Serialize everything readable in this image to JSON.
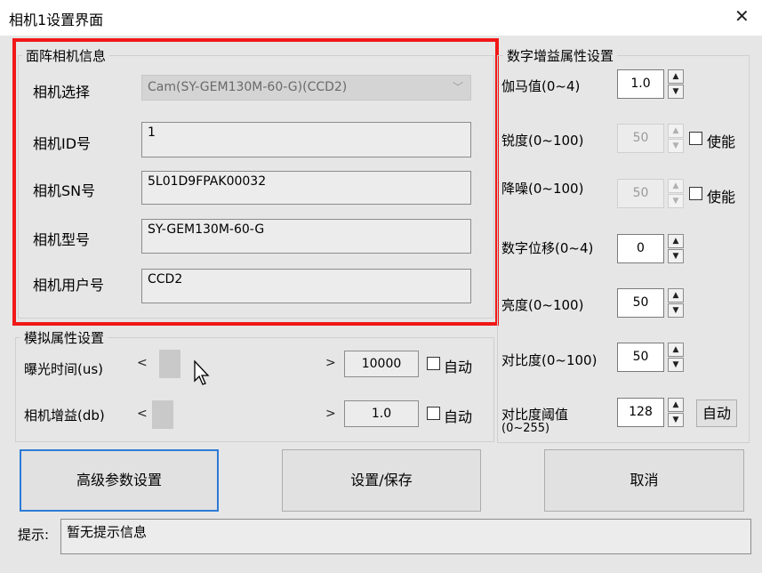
{
  "window": {
    "title": "相机1设置界面"
  },
  "camera_info": {
    "group_title": "面阵相机信息",
    "select_label": "相机选择",
    "select_value": "Cam(SY-GEM130M-60-G)(CCD2)",
    "id_label": "相机ID号",
    "id_value": "1",
    "sn_label": "相机SN号",
    "sn_value": "5L01D9FPAK00032",
    "model_label": "相机型号",
    "model_value": "SY-GEM130M-60-G",
    "user_label": "相机用户号",
    "user_value": "CCD2"
  },
  "analog": {
    "group_title": "模拟属性设置",
    "exposure_label": "曝光时间(us)",
    "exposure_value": "10000",
    "exposure_auto": "自动",
    "gain_label": "相机增益(db)",
    "gain_value": "1.0",
    "gain_auto": "自动",
    "left_arrow": "<",
    "right_arrow": ">"
  },
  "digital": {
    "group_title": "数字增益属性设置",
    "gamma_label": "伽马值(0~4)",
    "gamma_value": "1.0",
    "sharpness_label": "锐度(0~100)",
    "sharpness_value": "50",
    "sharpness_enable": "使能",
    "denoise_label": "降噪(0~100)",
    "denoise_value": "50",
    "denoise_enable": "使能",
    "shift_label": "数字位移(0~4)",
    "shift_value": "0",
    "brightness_label": "亮度(0~100)",
    "brightness_value": "50",
    "contrast_label": "对比度(0~100)",
    "contrast_value": "50",
    "contrast_threshold_label": "对比度阈值",
    "contrast_threshold_range": "(0~255)",
    "contrast_threshold_value": "128",
    "contrast_threshold_auto": "自动",
    "spin_up": "▲",
    "spin_down": "▼"
  },
  "buttons": {
    "advanced": "高级参数设置",
    "save": "设置/保存",
    "cancel": "取消"
  },
  "hint": {
    "label": "提示:",
    "value": "暂无提示信息"
  },
  "colors": {
    "highlight_border": "#f01818",
    "focus_border": "#2c7bd6"
  }
}
